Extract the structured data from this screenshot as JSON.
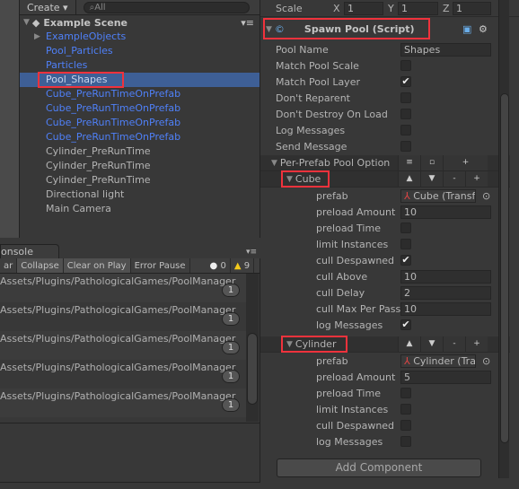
{
  "hierarchy": {
    "create": "Create ▾",
    "search_placeholder": "All",
    "scene": "Example Scene",
    "items": [
      {
        "label": "ExampleObjects",
        "color": "blue",
        "expand": true
      },
      {
        "label": "Pool_Particles",
        "color": "blue"
      },
      {
        "label": "Particles",
        "color": "blue"
      },
      {
        "label": "Pool_Shapes",
        "color": "blue",
        "selected": true
      },
      {
        "label": "Cube_PreRunTimeOnPrefab",
        "color": "blue"
      },
      {
        "label": "Cube_PreRunTimeOnPrefab",
        "color": "blue"
      },
      {
        "label": "Cube_PreRunTimeOnPrefab",
        "color": "blue"
      },
      {
        "label": "Cube_PreRunTimeOnPrefab",
        "color": "blue"
      },
      {
        "label": "Cylinder_PreRunTime"
      },
      {
        "label": "Cylinder_PreRunTime"
      },
      {
        "label": "Cylinder_PreRunTime"
      },
      {
        "label": "Directional light"
      },
      {
        "label": "Main Camera"
      }
    ]
  },
  "console": {
    "tab": "onsole",
    "toolbar": [
      "ar",
      "Collapse",
      "Clear on Play",
      "Error Pause"
    ],
    "errors": "0",
    "warnings": "9",
    "rows": [
      "Assets/Plugins/PathologicalGames/PoolManager",
      "Assets/Plugins/PathologicalGames/PoolManager",
      "Assets/Plugins/PathologicalGames/PoolManager",
      "Assets/Plugins/PathologicalGames/PoolManager",
      "Assets/Plugins/PathologicalGames/PoolManager"
    ],
    "count": "1"
  },
  "inspector": {
    "scale": {
      "label": "Scale",
      "x": "1",
      "y": "1",
      "z": "1"
    },
    "component": "Spawn Pool (Script)",
    "pool_name": {
      "label": "Pool Name",
      "value": "Shapes"
    },
    "toggles": [
      {
        "label": "Match Pool Scale",
        "checked": false
      },
      {
        "label": "Match Pool Layer",
        "checked": true
      },
      {
        "label": "Don't Reparent",
        "checked": false
      },
      {
        "label": "Don't Destroy On Load",
        "checked": false
      },
      {
        "label": "Log Messages",
        "checked": false
      },
      {
        "label": "Send Message",
        "checked": false
      }
    ],
    "per_prefab": "Per-Prefab Pool Option",
    "pools": [
      {
        "name": "Cube",
        "prefab": "Cube (Transform)",
        "preload_amount": "10",
        "rows": [
          {
            "label": "prefab",
            "type": "object"
          },
          {
            "label": "preload Amount",
            "type": "text",
            "value": "10"
          },
          {
            "label": "preload Time",
            "checked": false
          },
          {
            "label": "limit Instances",
            "checked": false
          },
          {
            "label": "cull Despawned",
            "checked": true
          },
          {
            "label": "cull Above",
            "type": "text",
            "value": "10"
          },
          {
            "label": "cull Delay",
            "type": "text",
            "value": "2"
          },
          {
            "label": "cull Max Per Pass",
            "type": "text",
            "value": "10"
          },
          {
            "label": "log Messages",
            "checked": true
          }
        ]
      },
      {
        "name": "Cylinder",
        "prefab": "Cylinder (Transform)",
        "rows": [
          {
            "label": "prefab",
            "type": "object"
          },
          {
            "label": "preload Amount",
            "type": "text",
            "value": "5"
          },
          {
            "label": "preload Time",
            "checked": false
          },
          {
            "label": "limit Instances",
            "checked": false
          },
          {
            "label": "cull Despawned",
            "checked": false
          },
          {
            "label": "log Messages",
            "checked": false
          }
        ]
      }
    ],
    "add_component": "Add Component"
  }
}
